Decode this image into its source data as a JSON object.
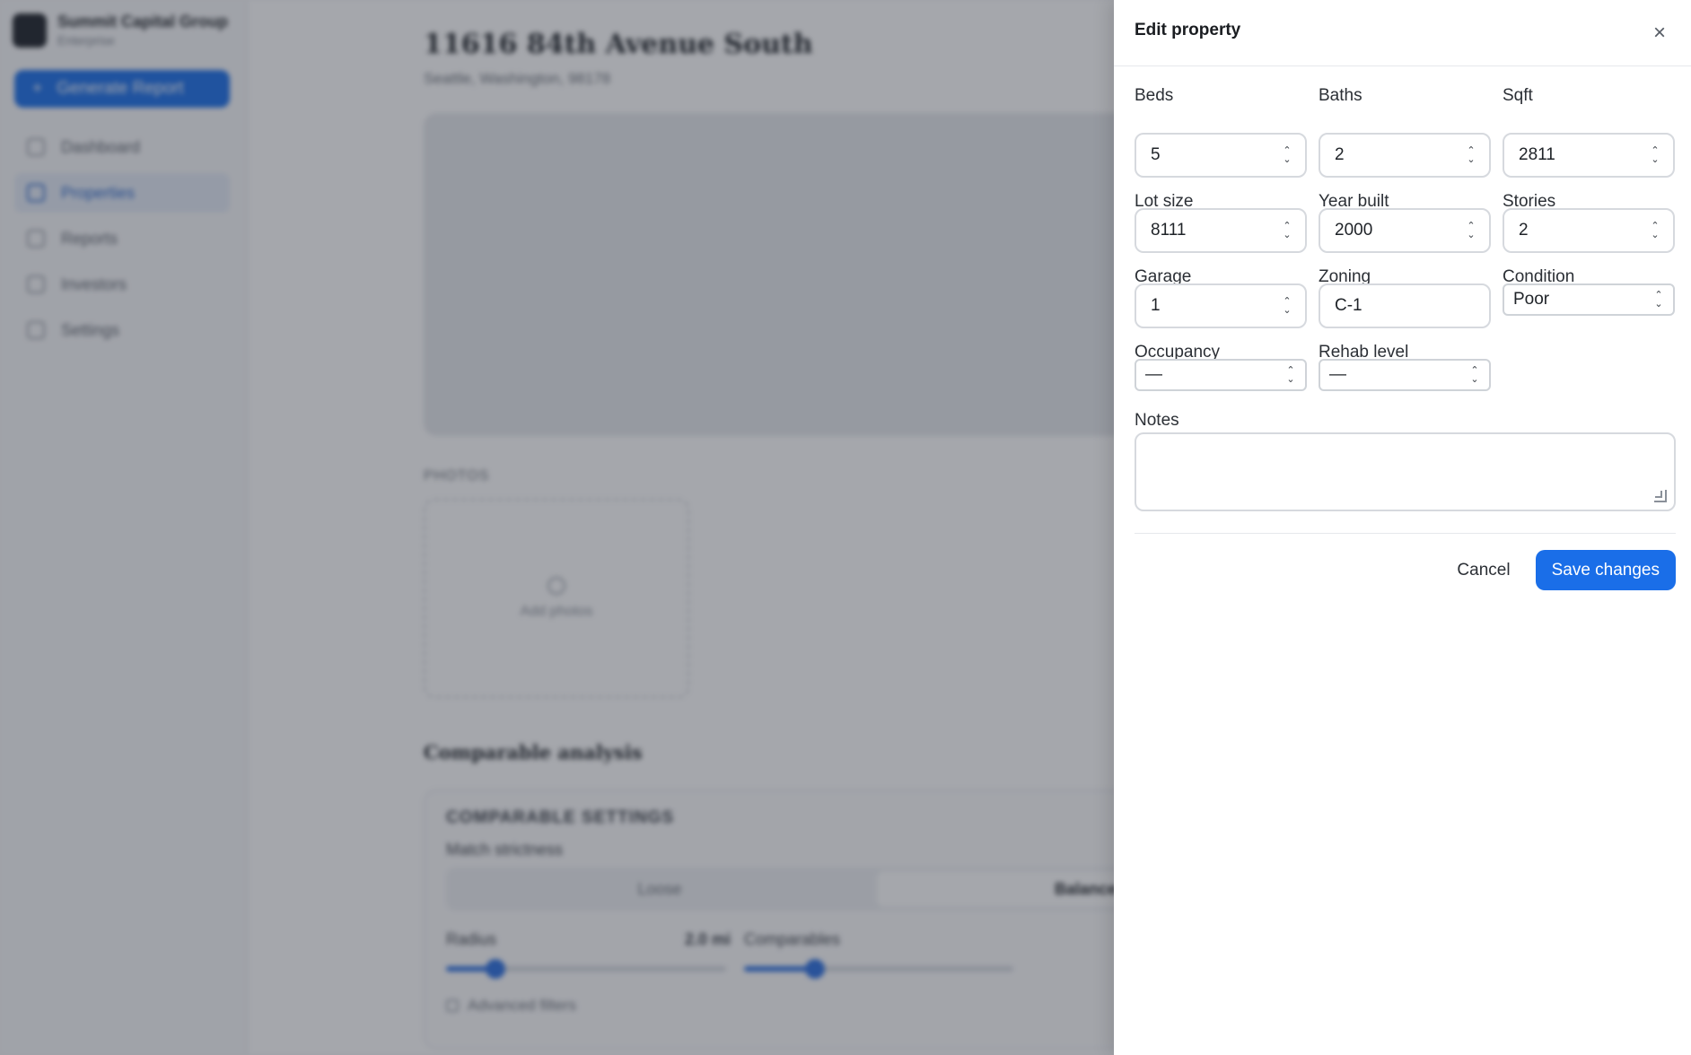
{
  "background": {
    "org_name": "Summit Capital Group",
    "org_sub": "Enterprise",
    "generate_label": "Generate Report",
    "nav": [
      {
        "label": "Dashboard"
      },
      {
        "label": "Properties"
      },
      {
        "label": "Reports"
      },
      {
        "label": "Investors"
      },
      {
        "label": "Settings"
      }
    ],
    "address": "11616 84th Avenue South",
    "address_sub": "Seattle, Washington, 98178",
    "photos_label": "PHOTOS",
    "add_photos": "Add photos",
    "comparable_title": "Comparable analysis",
    "comparable_settings": "COMPARABLE SETTINGS",
    "match_strictness": "Match strictness",
    "strictness_options": [
      "Loose",
      "Balanced"
    ],
    "radius_label": "Radius",
    "radius_value": "2.0 mi",
    "comparables_label": "Comparables",
    "advanced_filters": "Advanced filters"
  },
  "drawer": {
    "title": "Edit property",
    "close_icon": "close-icon",
    "fields": {
      "beds": {
        "label": "Beds",
        "value": "5"
      },
      "baths": {
        "label": "Baths",
        "value": "2"
      },
      "sqft": {
        "label": "Sqft",
        "value": "2811"
      },
      "lot_size": {
        "label": "Lot size",
        "value": "8111"
      },
      "year_built": {
        "label": "Year built",
        "value": "2000"
      },
      "stories": {
        "label": "Stories",
        "value": "2"
      },
      "garage": {
        "label": "Garage",
        "value": "1"
      },
      "zoning": {
        "label": "Zoning",
        "value": "C-1"
      },
      "condition": {
        "label": "Condition",
        "value": "Poor"
      },
      "occupancy": {
        "label": "Occupancy",
        "value": "—"
      },
      "rehab_level": {
        "label": "Rehab level",
        "value": "—"
      },
      "notes": {
        "label": "Notes",
        "value": ""
      }
    },
    "cancel_label": "Cancel",
    "save_label": "Save changes"
  },
  "colors": {
    "accent": "#1a6ee8",
    "scrim": "rgba(40,46,58,0.42)"
  }
}
